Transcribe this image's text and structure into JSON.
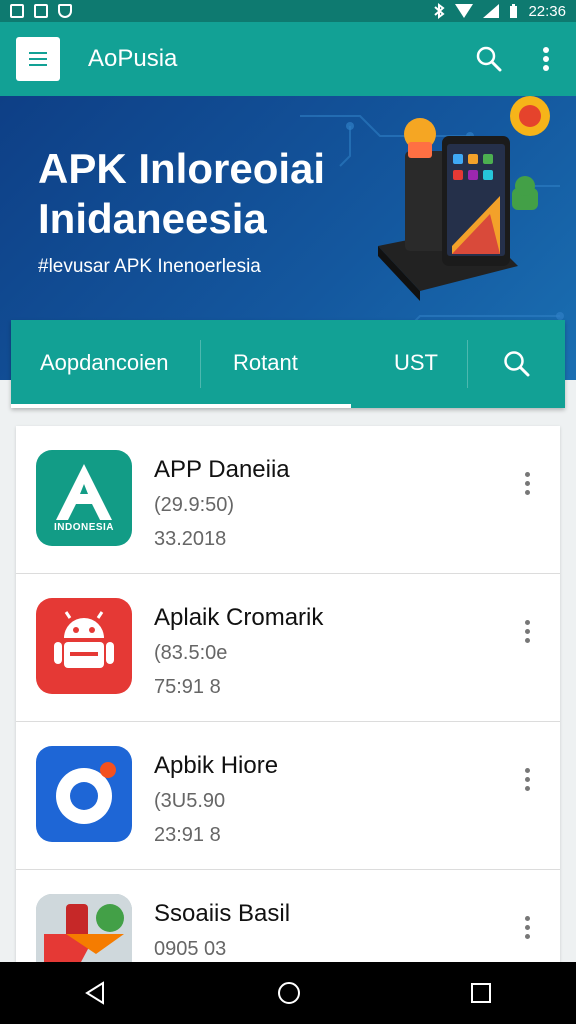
{
  "status_bar": {
    "time": "22:36"
  },
  "app_bar": {
    "title": "AoPusia"
  },
  "banner": {
    "title_line1": "APK Inloreoiai",
    "title_line2": "Inidaneesia",
    "subtitle": "#levusar APK Inenoerlesia"
  },
  "tabs": [
    {
      "label": "Aopdancoien",
      "selected": true
    },
    {
      "label": "Rotant"
    },
    {
      "label": "UST"
    }
  ],
  "apps": [
    {
      "name": "APP Daneiia",
      "line1": "(29.9:50)",
      "line2": "33.2018",
      "icon": "green-a-icon",
      "icon_text": "INDONESIA"
    },
    {
      "name": "Aplaik Cromarik",
      "line1": "(83.5:0e",
      "line2": "75:91 8",
      "icon": "android-red-icon"
    },
    {
      "name": "Apbik Hiore",
      "line1": "(3U5.90",
      "line2": "23:91 8",
      "icon": "blue-circle-icon"
    },
    {
      "name": "Ssoaiis Basil",
      "line1": "0905 03",
      "line2": "",
      "icon": "shapes-icon"
    }
  ],
  "colors": {
    "primary": "#12a195",
    "primary_dark": "#0e7a70",
    "banner": "#14589f"
  }
}
